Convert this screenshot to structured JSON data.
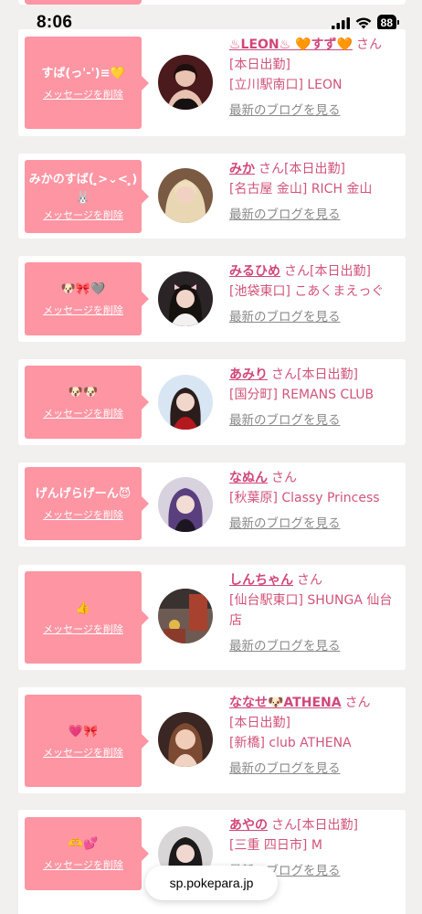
{
  "status_bar": {
    "time": "8:06",
    "battery": "88"
  },
  "browser": {
    "url": "sp.pokepara.jp"
  },
  "delete_label": "メッセージを削除",
  "entries": [
    {
      "message": "すば(っ'-')≡💛",
      "name": "♨LEON♨ 🧡すず🧡",
      "honorific": "さん",
      "status": "[本日出勤]",
      "shop": "[立川駅南口] LEON",
      "blog_link": "最新のブログを見る"
    },
    {
      "message": "みかのすば(́ ̥̥̥>⌄< ̥̥̥)🐰",
      "name": "みか",
      "honorific": "さん",
      "status": "[本日出勤]",
      "shop": "[名古屋 金山] RICH 金山",
      "blog_link": "最新のブログを見る"
    },
    {
      "message": "🐶🎀🩶",
      "name": "みるひめ",
      "honorific": "さん",
      "status": "[本日出勤]",
      "shop": "[池袋東口] こあくまえっぐ",
      "blog_link": "最新のブログを見る"
    },
    {
      "message": "🐶🐶",
      "name": "あみり",
      "honorific": "さん",
      "status": "[本日出勤]",
      "shop": "[国分町] REMANS CLUB",
      "blog_link": "最新のブログを見る"
    },
    {
      "message": "げんげらげーん😈",
      "name": "なぬん",
      "honorific": "さん",
      "status": "",
      "shop": "[秋葉原] Classy Princess",
      "blog_link": "最新のブログを見る"
    },
    {
      "message": "👍",
      "name": "しんちゃん",
      "honorific": "さん",
      "status": "",
      "shop": "[仙台駅東口] SHUNGA 仙台店",
      "blog_link": "最新のブログを見る"
    },
    {
      "message": "💗🎀",
      "name": "ななせ🐶ATHENA",
      "honorific": "さん",
      "status": "[本日出勤]",
      "shop": "[新橋] club ATHENA",
      "blog_link": "最新のブログを見る"
    },
    {
      "message": "🫶💕",
      "name": "あやの",
      "honorific": "さん",
      "status": "[本日出勤]",
      "shop": "[三重 四日市] M",
      "blog_link": "最新のブログを見る"
    }
  ]
}
